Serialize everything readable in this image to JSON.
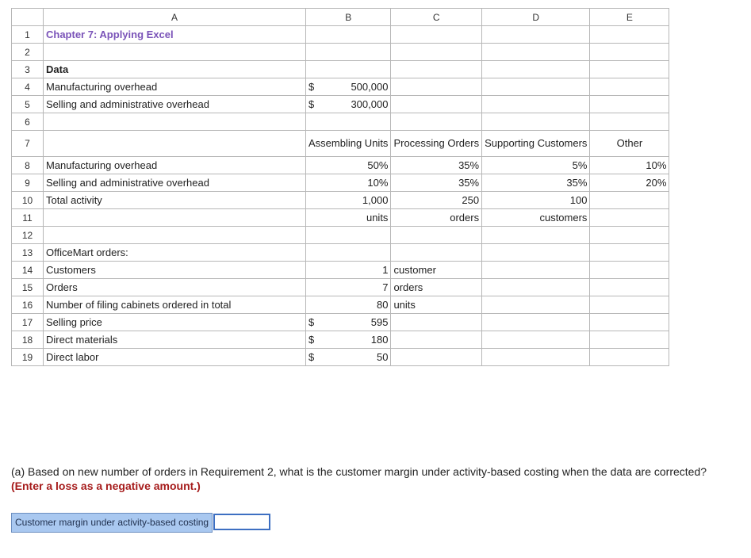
{
  "columns": [
    "A",
    "B",
    "C",
    "D",
    "E"
  ],
  "rows": {
    "r1": {
      "num": "1",
      "a": "Chapter 7: Applying Excel"
    },
    "r2": {
      "num": "2"
    },
    "r3": {
      "num": "3",
      "a": "Data"
    },
    "r4": {
      "num": "4",
      "a": "Manufacturing overhead",
      "b_cur": "$",
      "b_val": "500,000"
    },
    "r5": {
      "num": "5",
      "a": "Selling and administrative overhead",
      "b_cur": "$",
      "b_val": "300,000"
    },
    "r6": {
      "num": "6"
    },
    "r7": {
      "num": "7",
      "b": "Assembling Units",
      "c": "Processing Orders",
      "d": "Supporting Customers",
      "e": "Other"
    },
    "r8": {
      "num": "8",
      "a": "Manufacturing overhead",
      "b": "50%",
      "c": "35%",
      "d": "5%",
      "e": "10%"
    },
    "r9": {
      "num": "9",
      "a": "Selling and administrative overhead",
      "b": "10%",
      "c": "35%",
      "d": "35%",
      "e": "20%"
    },
    "r10": {
      "num": "10",
      "a": "Total activity",
      "b": "1,000",
      "c": "250",
      "d": "100"
    },
    "r11": {
      "num": "11",
      "b": "units",
      "c": "orders",
      "d": "customers"
    },
    "r12": {
      "num": "12"
    },
    "r13": {
      "num": "13",
      "a": "OfficeMart orders:"
    },
    "r14": {
      "num": "14",
      "a": "Customers",
      "b": "1",
      "c": "customer"
    },
    "r15": {
      "num": "15",
      "a": "Orders",
      "b": "7",
      "c": "orders"
    },
    "r16": {
      "num": "16",
      "a": "Number of filing cabinets ordered in total",
      "b": "80",
      "c": "units"
    },
    "r17": {
      "num": "17",
      "a": "Selling price",
      "b_cur": "$",
      "b_val": "595"
    },
    "r18": {
      "num": "18",
      "a": "Direct materials",
      "b_cur": "$",
      "b_val": "180"
    },
    "r19": {
      "num": "19",
      "a": "Direct labor",
      "b_cur": "$",
      "b_val": "50"
    }
  },
  "question": {
    "text": "(a) Based on new number of orders in Requirement 2, what is the customer margin under activity-based costing when the data are corrected?",
    "emphasis": "(Enter a loss as a negative amount.)"
  },
  "answer": {
    "label": "Customer margin under activity-based costing",
    "value": ""
  }
}
